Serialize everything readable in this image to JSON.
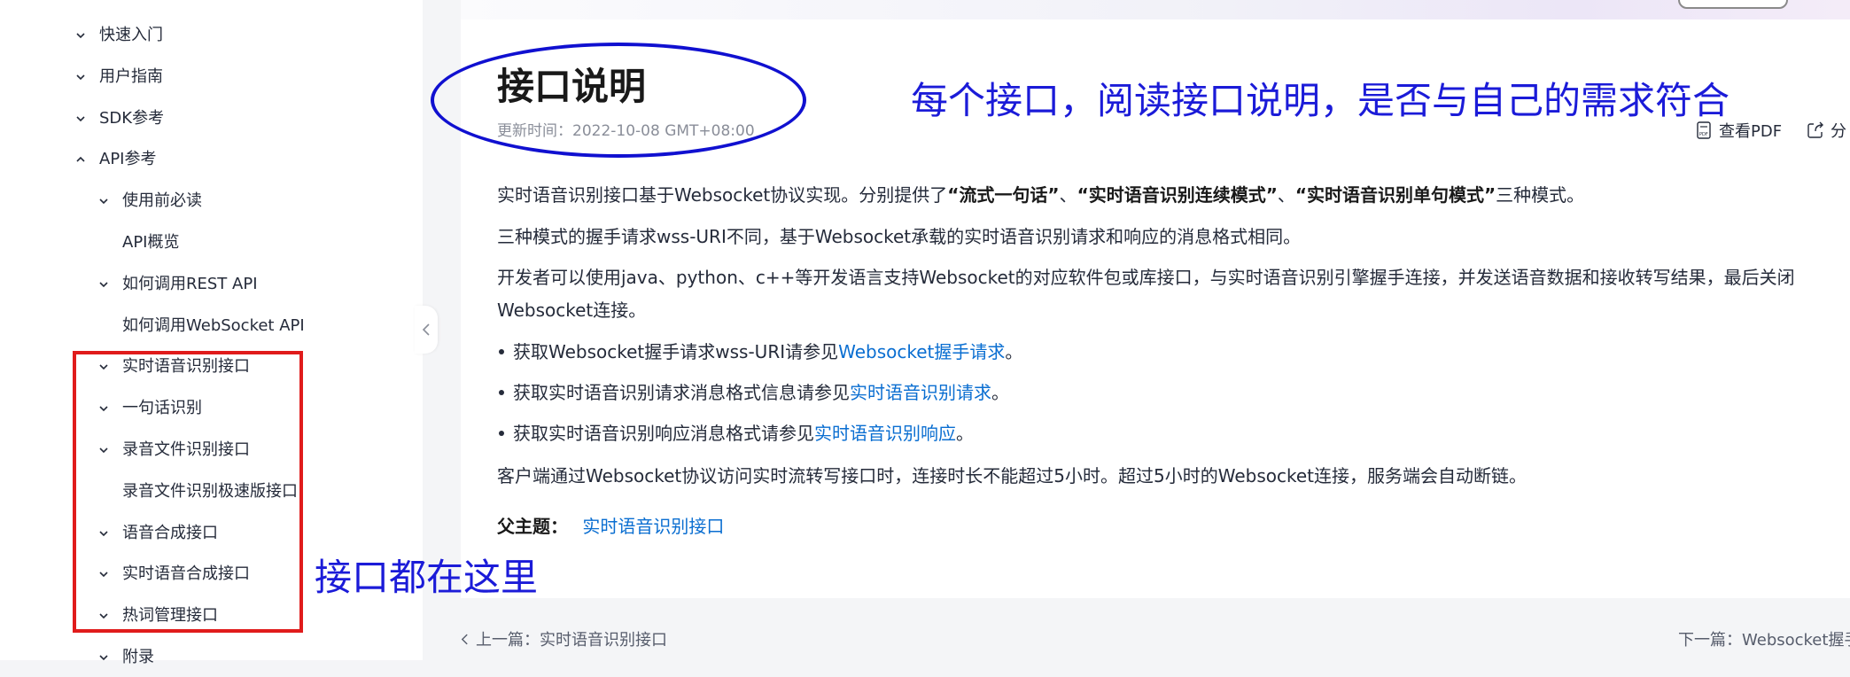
{
  "sidebar": {
    "items": [
      {
        "label": "快速入门",
        "chevron": "down",
        "level": 0
      },
      {
        "label": "用户指南",
        "chevron": "down",
        "level": 0
      },
      {
        "label": "SDK参考",
        "chevron": "down",
        "level": 0
      },
      {
        "label": "API参考",
        "chevron": "up",
        "level": 0
      },
      {
        "label": "使用前必读",
        "chevron": "down",
        "level": 1
      },
      {
        "label": "API概览",
        "chevron": "none",
        "level": 1
      },
      {
        "label": "如何调用REST API",
        "chevron": "down",
        "level": 1
      },
      {
        "label": "如何调用WebSocket API",
        "chevron": "none",
        "level": 1
      },
      {
        "label": "实时语音识别接口",
        "chevron": "down",
        "level": 1
      },
      {
        "label": "一句话识别",
        "chevron": "down",
        "level": 1
      },
      {
        "label": "录音文件识别接口",
        "chevron": "down",
        "level": 1
      },
      {
        "label": "录音文件识别极速版接口",
        "chevron": "none",
        "level": 1
      },
      {
        "label": "语音合成接口",
        "chevron": "down",
        "level": 1
      },
      {
        "label": "实时语音合成接口",
        "chevron": "down",
        "level": 1
      },
      {
        "label": "热词管理接口",
        "chevron": "down",
        "level": 1
      },
      {
        "label": "附录",
        "chevron": "down",
        "level": 1
      }
    ]
  },
  "main": {
    "title": "接口说明",
    "update_time": "更新时间：2022-10-08 GMT+08:00",
    "toolbar": {
      "pdf_label": "查看PDF",
      "share_label": "分"
    },
    "p1": {
      "a": "实时语音识别接口基于Websocket协议实现。分别提供了",
      "b1": "“流式一句话”",
      "c": "、",
      "b2": "“实时语音识别连续模式”",
      "d": "、",
      "b3": "“实时语音识别单句模式”",
      "e": "三种模式。"
    },
    "p2": "三种模式的握手请求wss-URI不同，基于Websocket承载的实时语音识别请求和响应的消息格式相同。",
    "p3_line1": "开发者可以使用java、python、c++等开发语言支持Websocket的对应软件包或库接口，与实时语音识别引擎握手连接，并发送语音数据和接收转写结果，最后关闭",
    "p3_line2": "Websocket连接。",
    "bullets": [
      {
        "text": "获取Websocket握手请求wss-URI请参见",
        "link": "Websocket握手请求",
        "tail": "。"
      },
      {
        "text": "获取实时语音识别请求消息格式信息请参见",
        "link": "实时语音识别请求",
        "tail": "。"
      },
      {
        "text": "获取实时语音识别响应消息格式请参见",
        "link": "实时语音识别响应",
        "tail": "。"
      }
    ],
    "p4": "客户端通过Websocket协议访问实时流转写接口时，连接时长不能超过5小时。超过5小时的Websocket连接，服务端会自动断链。",
    "parent_label": "父主题：",
    "parent_link": "实时语音识别接口"
  },
  "footer": {
    "prev": "上一篇：实时语音识别接口",
    "next": "下一篇：Websocket握手"
  },
  "annotations": {
    "top_note": "每个接口，阅读接口说明，是否与自己的需求符合",
    "left_note": "接口都在这里",
    "ellipse_color": "#1010d0",
    "rect_color": "#e01b1b",
    "text_color": "#1b1bd8"
  },
  "colors": {
    "link": "#0a6ed1",
    "text": "#252b3a",
    "muted": "#8a8e99"
  }
}
